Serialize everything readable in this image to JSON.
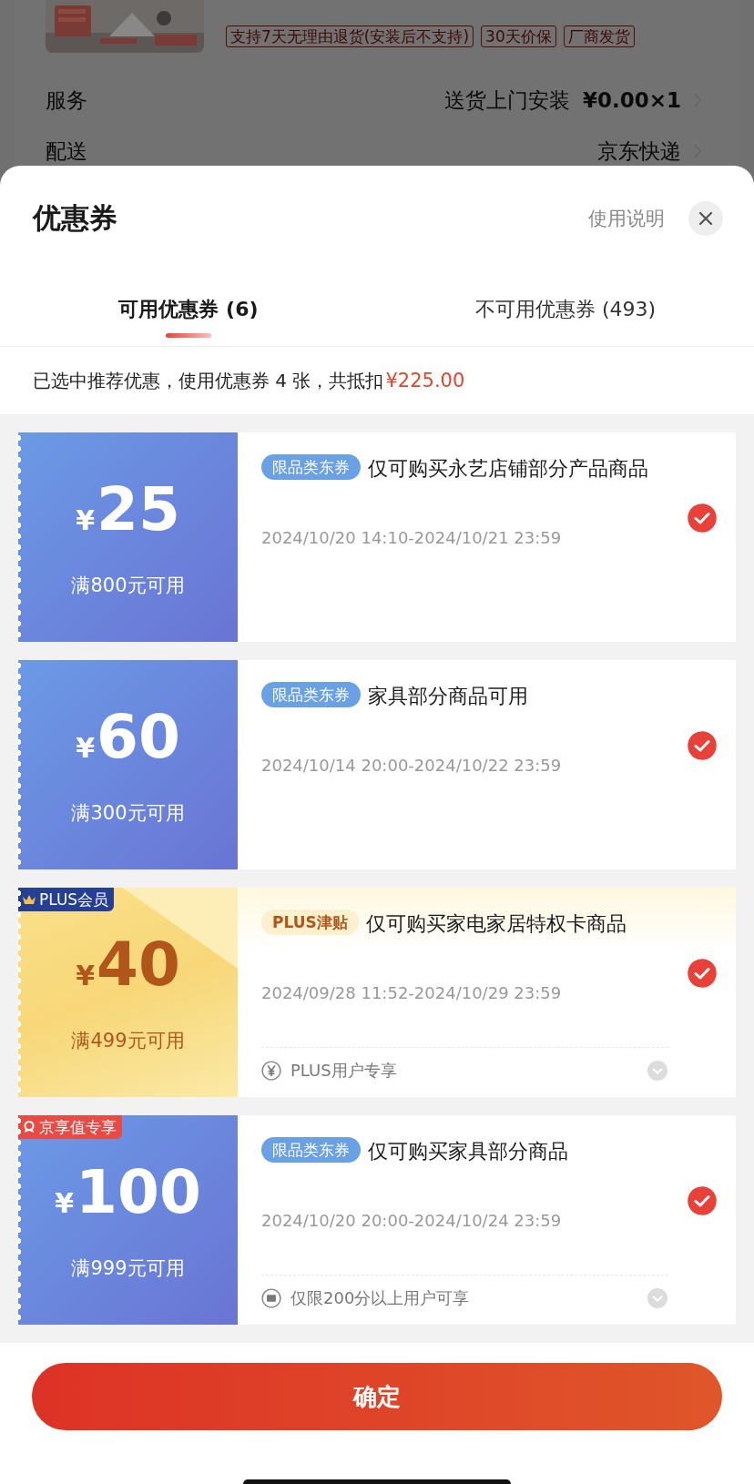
{
  "background_page": {
    "thumbnail": {
      "kind": "picture"
    },
    "service_tags": [
      "支持7天无理由退货(安装后不支持)",
      "30天价保",
      "厂商发货"
    ],
    "rows": [
      {
        "label": "服务",
        "value": "送货上门安装",
        "price": "¥0.00×1"
      },
      {
        "label": "配送",
        "value": "京东快递"
      }
    ]
  },
  "sheet": {
    "title": "优惠券",
    "help_link": "使用说明",
    "tabs": [
      {
        "label": "可用优惠券 (6)",
        "selected": true
      },
      {
        "label": "不可用优惠券 (493)",
        "selected": false
      }
    ],
    "summary": {
      "text": "已选中推荐优惠，使用优惠券 4 张，共抵扣",
      "amount": "¥225.00"
    },
    "coupons": [
      {
        "kind": "blue",
        "currency": "¥",
        "amount": "25",
        "condition": "满800元可用",
        "tag": "限品类东券",
        "description": "仅可购买永艺店铺部分产品商品",
        "period": "2024/10/20 14:10-2024/10/21 23:59",
        "selected": true
      },
      {
        "kind": "blue",
        "currency": "¥",
        "amount": "60",
        "condition": "满300元可用",
        "tag": "限品类东券",
        "description": "家具部分商品可用",
        "period": "2024/10/14 20:00-2024/10/22 23:59",
        "selected": true
      },
      {
        "kind": "plus",
        "currency": "¥",
        "amount": "40",
        "condition": "满499元可用",
        "corner_badge": {
          "kind": "plus",
          "text": "PLUS会员"
        },
        "tag": "PLUS津贴",
        "description": "仅可购买家电家居特权卡商品",
        "period": "2024/09/28 11:52-2024/10/29 23:59",
        "footer": {
          "kind": "yen",
          "text": "PLUS用户专享"
        },
        "selected": true
      },
      {
        "kind": "blue",
        "currency": "¥",
        "amount": "100",
        "condition": "满999元可用",
        "corner_badge": {
          "kind": "score",
          "text": "京享值专享"
        },
        "tag": "限品类东券",
        "description": "仅可购买家具部分商品",
        "period": "2024/10/20 20:00-2024/10/24 23:59",
        "footer": {
          "kind": "card",
          "text": "仅限200分以上用户可享"
        },
        "selected": true
      }
    ],
    "confirm_button": "确定"
  }
}
